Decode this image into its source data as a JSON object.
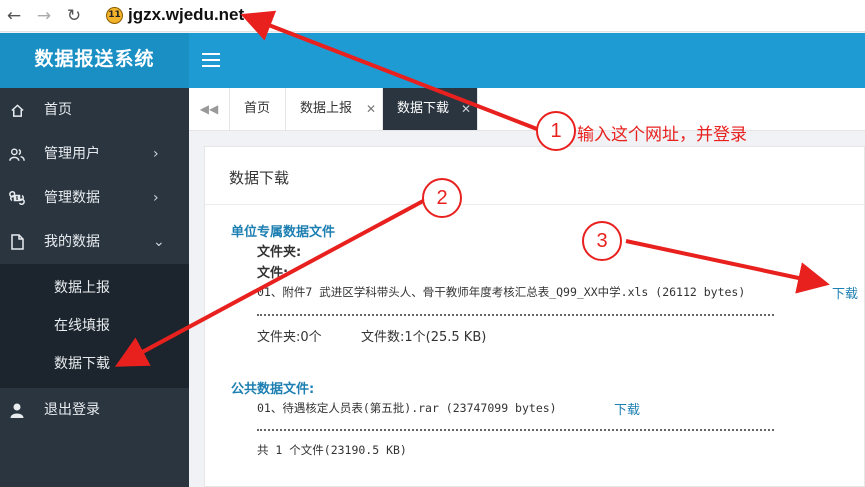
{
  "browser": {
    "badge": "11",
    "url": "jgzx.wjedu.net"
  },
  "header": {
    "title": "数据报送系统"
  },
  "sidebar": {
    "items": [
      {
        "label": "首页"
      },
      {
        "label": "管理用户",
        "chevron": "›"
      },
      {
        "label": "管理数据",
        "chevron": "›"
      },
      {
        "label": "我的数据",
        "chevron": "⌄"
      },
      {
        "label": "退出登录"
      }
    ],
    "submenu": [
      {
        "label": "数据上报"
      },
      {
        "label": "在线填报"
      },
      {
        "label": "数据下载"
      }
    ]
  },
  "tabs": [
    {
      "label": "首页"
    },
    {
      "label": "数据上报",
      "close": "✕"
    },
    {
      "label": "数据下载",
      "close": "✕",
      "active": true
    }
  ],
  "panel": {
    "title": "数据下载",
    "unit_section": {
      "title": "单位专属数据文件",
      "folder_label": "文件夹:",
      "file_label": "文件:",
      "file_entry": "01、附件7 武进区学科带头人、骨干教师年度考核汇总表_Q99_XX中学.xls (26112 bytes)",
      "download_label": "下载",
      "summary_folders": "文件夹:0个",
      "summary_files": "文件数:1个(25.5 KB)"
    },
    "public_section": {
      "title": "公共数据文件:",
      "file_entry": "01、待遇核定人员表(第五批).rar (23747099 bytes)",
      "download_label": "下载",
      "summary": "共  1  个文件(23190.5 KB)"
    }
  },
  "annotations": {
    "step1_number": "1",
    "step1_text": "输入这个网址，并登录",
    "step2_number": "2",
    "step3_number": "3",
    "color": "#e8211f"
  }
}
